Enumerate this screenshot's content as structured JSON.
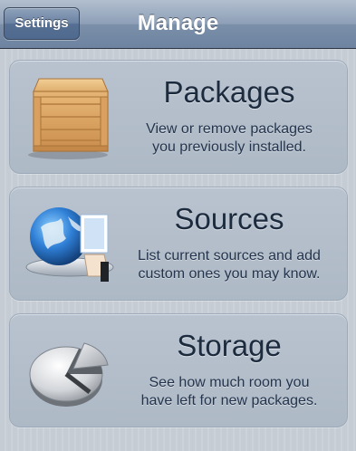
{
  "navbar": {
    "back_label": "Settings",
    "title": "Manage"
  },
  "cards": [
    {
      "title": "Packages",
      "description": [
        "View or remove packages",
        "you previously installed."
      ],
      "icon": "wooden-crate-icon"
    },
    {
      "title": "Sources",
      "description": [
        "List current sources and add",
        "custom ones you may know."
      ],
      "icon": "globe-document-tray-icon"
    },
    {
      "title": "Storage",
      "description": [
        "See how much room you",
        "have left for new packages."
      ],
      "icon": "pie-chart-disk-icon"
    }
  ]
}
